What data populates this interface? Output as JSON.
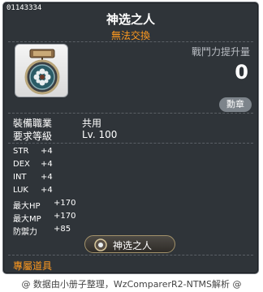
{
  "item": {
    "id": "01143334",
    "name": "神选之人",
    "trade_status": "無法交換"
  },
  "power": {
    "label": "戰鬥力提升量",
    "value": "0"
  },
  "badge": "勳章",
  "requirements": [
    {
      "label": "裝備職業",
      "value": "共用"
    },
    {
      "label": "要求等級",
      "value": "Lv. 100"
    }
  ],
  "stats": [
    {
      "label": "STR",
      "value": "+4"
    },
    {
      "label": "DEX",
      "value": "+4"
    },
    {
      "label": "INT",
      "value": "+4"
    },
    {
      "label": "LUK",
      "value": "+4"
    },
    {
      "label": "最大HP",
      "value": "+170"
    },
    {
      "label": "最大MP",
      "value": "+170"
    },
    {
      "label": "防禦力",
      "value": "+85"
    }
  ],
  "set_label": "神选之人",
  "exclusive_label": "專屬道具",
  "footer": "@ 数据由小册子整理，WzComparerR2-NTMS解析 @",
  "colors": {
    "background": "#2f3439",
    "accent_orange": "#ff9a1f",
    "text": "#ffffff"
  },
  "icons": [
    "medal-icon",
    "set-emblem-icon"
  ]
}
